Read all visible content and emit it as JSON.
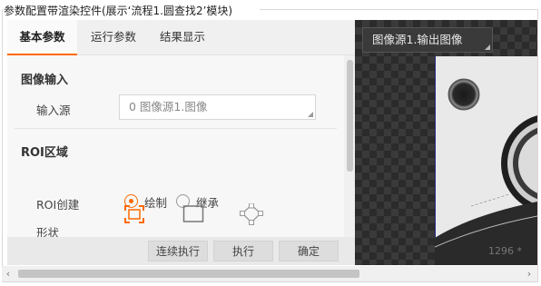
{
  "window": {
    "title": "参数配置带渲染控件(展示‘流程1.圆查找2’模块)"
  },
  "tabs": [
    {
      "label": "基本参数",
      "active": true
    },
    {
      "label": "运行参数",
      "active": false
    },
    {
      "label": "结果显示",
      "active": false
    }
  ],
  "image_input": {
    "section_title": "图像输入",
    "source_label": "输入源",
    "source_value": "0 图像源1.图像"
  },
  "roi": {
    "section_title": "ROI区域",
    "create_label": "ROI创建",
    "options": [
      {
        "label": "绘制",
        "selected": true
      },
      {
        "label": "继承",
        "selected": false
      }
    ],
    "shape_label": "形状",
    "shapes": [
      {
        "icon": "rectangle-roi-icon",
        "selected": true
      },
      {
        "icon": "rectangle-outline-icon",
        "selected": false
      },
      {
        "icon": "polygon-roi-icon",
        "selected": false
      }
    ]
  },
  "buttons": {
    "continuous": "连续执行",
    "execute": "执行",
    "confirm": "确定"
  },
  "viewer": {
    "source_select": "图像源1.输出图像",
    "pixel_info": "1296 *"
  },
  "colors": {
    "accent": "#ff6a00",
    "viewer_bg": "#2b2b2b"
  }
}
